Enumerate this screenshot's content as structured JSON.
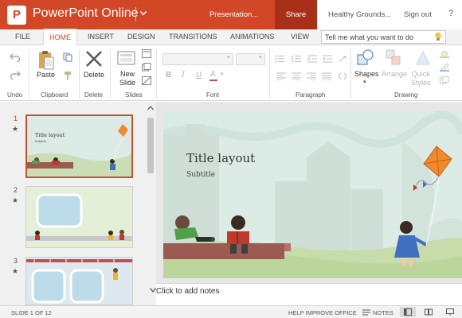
{
  "app": {
    "logo_letter": "P",
    "name": "PowerPoint Online",
    "document_name": "Presentation...",
    "share_label": "Share",
    "account_name": "Healthy Grounds...",
    "signout_label": "Sign out",
    "help_label": "?"
  },
  "tabs": [
    {
      "label": "FILE",
      "active": false
    },
    {
      "label": "HOME",
      "active": true
    },
    {
      "label": "INSERT",
      "active": false
    },
    {
      "label": "DESIGN",
      "active": false
    },
    {
      "label": "TRANSITIONS",
      "active": false
    },
    {
      "label": "ANIMATIONS",
      "active": false
    },
    {
      "label": "VIEW",
      "active": false
    }
  ],
  "tellme": {
    "placeholder": "Tell me what you want to do"
  },
  "ribbon": {
    "groups": {
      "undo": "Undo",
      "clipboard": "Clipboard",
      "delete": "Delete",
      "slides": "Slides",
      "font": "Font",
      "paragraph": "Paragraph",
      "drawing": "Drawing"
    },
    "buttons": {
      "paste": "Paste",
      "delete": "Delete",
      "new_slide_line1": "New",
      "new_slide_line2": "Slide",
      "shapes": "Shapes",
      "arrange": "Arrange",
      "quick_styles_line1": "Quick",
      "quick_styles_line2": "Styles"
    },
    "font_glyphs": {
      "bold": "B",
      "italic": "I",
      "underline": "U",
      "color": "A"
    },
    "accent_color": "#d24726"
  },
  "slides": [
    {
      "number": "1",
      "selected": true,
      "thumb_title": "Title layout",
      "thumb_subtitle": "Subtitle"
    },
    {
      "number": "2",
      "selected": false
    },
    {
      "number": "3",
      "selected": false
    }
  ],
  "current_slide": {
    "title": "Title layout",
    "subtitle": "Subtitle"
  },
  "notes": {
    "placeholder": "Click to add notes"
  },
  "status": {
    "slide_counter": "SLIDE 1 OF 12",
    "help_improve": "HELP IMPROVE OFFICE",
    "notes_label": "NOTES"
  },
  "colors": {
    "brand": "#d24726",
    "share_bg": "#a83018",
    "slide_bg": "#dcebe5",
    "kite": "#f08a2c"
  }
}
